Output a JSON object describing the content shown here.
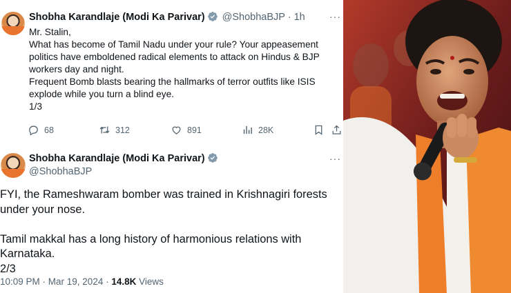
{
  "tweet1": {
    "author_name": "Shobha Karandlaje (Modi Ka Parivar)",
    "handle": "@ShobhaBJP",
    "separator": "·",
    "time": "1h",
    "text": "Mr. Stalin,\nWhat has become of Tamil Nadu under your rule? Your appeasement politics have emboldened radical elements to attack on Hindus & BJP workers day and night.\nFrequent Bomb blasts bearing the hallmarks of terror outfits like ISIS explode while you turn a blind eye.\n1/3",
    "replies": "68",
    "reposts": "312",
    "likes": "891",
    "views": "28K"
  },
  "tweet2": {
    "author_name": "Shobha Karandlaje (Modi Ka Parivar)",
    "handle": "@ShobhaBJP",
    "text": "FYI, the Rameshwaram bomber was trained in Krishnagiri forests under your nose.\n\nTamil makkal has a long history of harmonious relations with Karnataka.\n2/3",
    "timestamp": "10:09 PM · Mar 19, 2024 · ",
    "views_count": "14.8K",
    "views_label": " Views"
  },
  "icons": {
    "reply": "speech-bubble-icon",
    "repost": "repost-arrows-icon",
    "like": "heart-icon",
    "views": "bar-chart-icon",
    "bookmark": "bookmark-icon",
    "share": "share-icon",
    "verified": "verified-badge-icon",
    "more": "more-dots-icon"
  },
  "colors": {
    "text": "#0f1419",
    "secondary_text": "#536471",
    "verified_badge": "#829aab",
    "saffron": "#ee7e2a"
  }
}
